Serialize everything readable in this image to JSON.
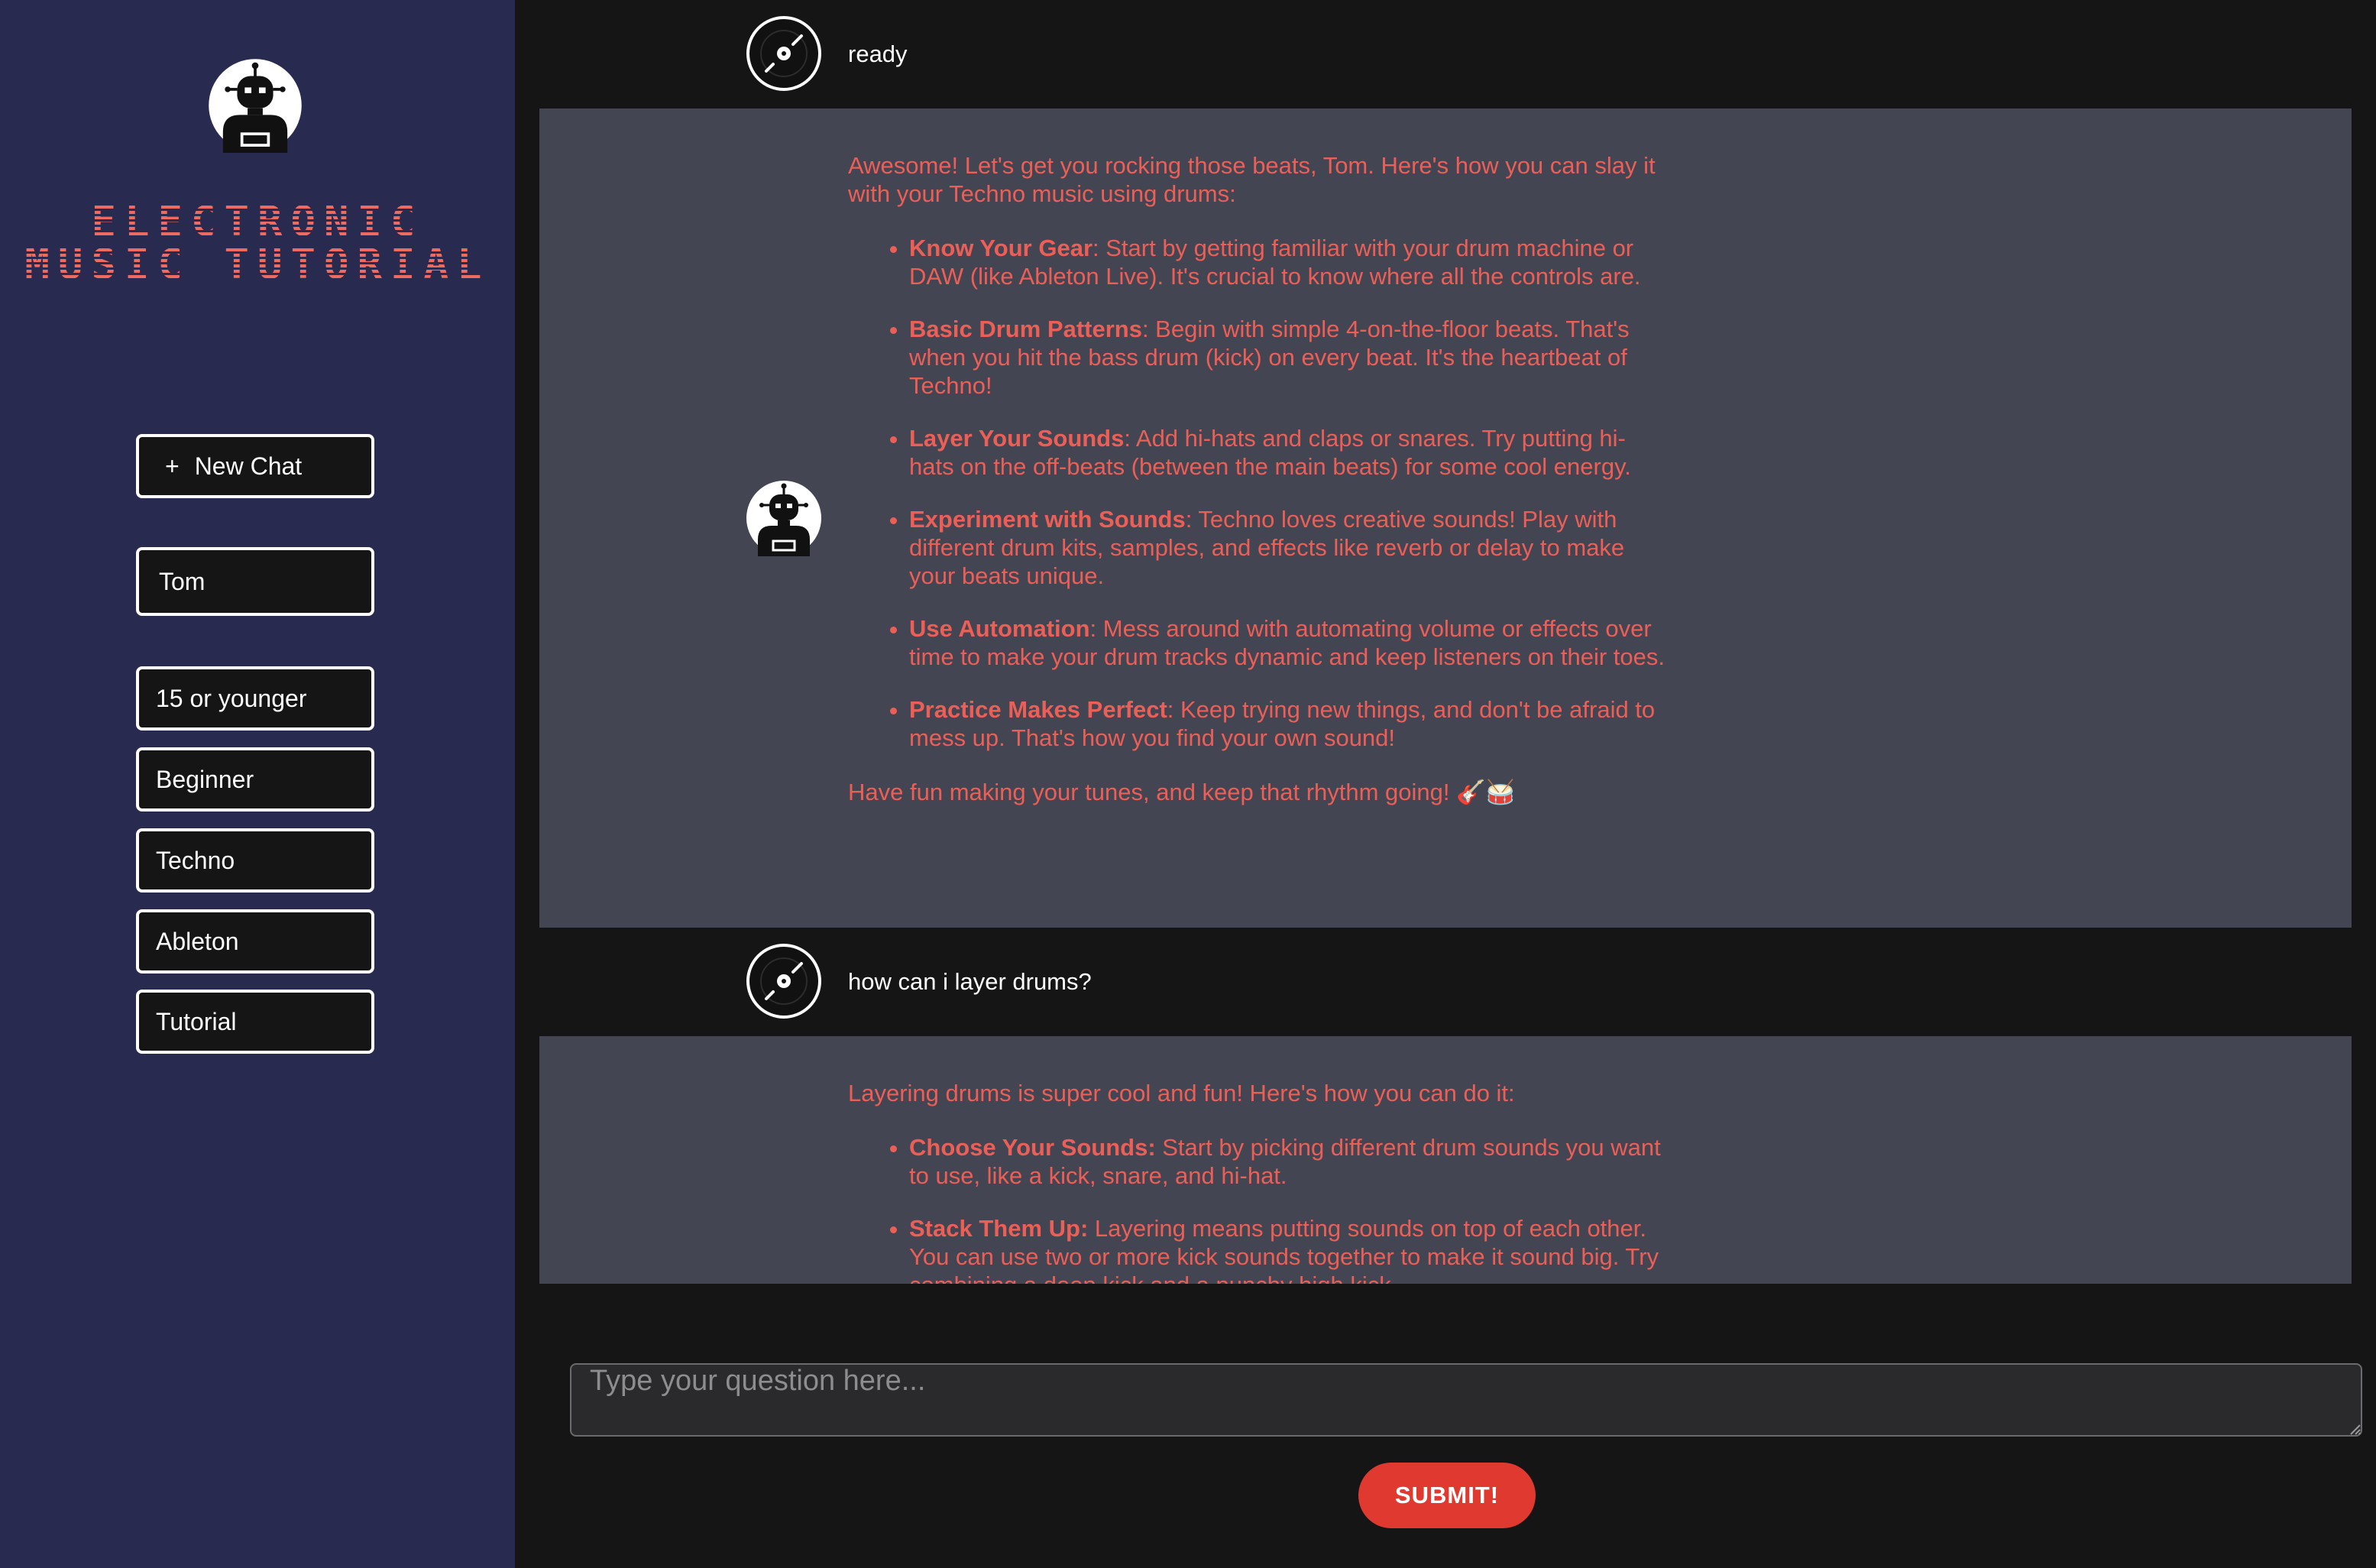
{
  "sidebar": {
    "title": "Electronic Music Tutorial",
    "new_chat_label": "New Chat",
    "name": "Tom",
    "age": "15 or younger",
    "level": "Beginner",
    "genre": "Techno",
    "software": "Ableton",
    "mode": "Tutorial"
  },
  "icons": {
    "logo": "robot-icon",
    "user_avatar": "vinyl-record-icon",
    "bot_avatar": "robot-icon",
    "new_chat": "plus-icon"
  },
  "messages": [
    {
      "role": "user",
      "text": "ready"
    },
    {
      "role": "bot",
      "intro": "Awesome! Let's get you rocking those beats, Tom. Here's how you can slay it with your Techno music using drums:",
      "items": [
        {
          "title": "Know Your Gear",
          "text": ": Start by getting familiar with your drum machine or DAW (like Ableton Live). It's crucial to know where all the controls are."
        },
        {
          "title": "Basic Drum Patterns",
          "text": ": Begin with simple 4-on-the-floor beats. That's when you hit the bass drum (kick) on every beat. It's the heartbeat of Techno!"
        },
        {
          "title": "Layer Your Sounds",
          "text": ": Add hi-hats and claps or snares. Try putting hi-hats on the off-beats (between the main beats) for some cool energy."
        },
        {
          "title": "Experiment with Sounds",
          "text": ": Techno loves creative sounds! Play with different drum kits, samples, and effects like reverb or delay to make your beats unique."
        },
        {
          "title": "Use Automation",
          "text": ": Mess around with automating volume or effects over time to make your drum tracks dynamic and keep listeners on their toes."
        },
        {
          "title": "Practice Makes Perfect",
          "text": ": Keep trying new things, and don't be afraid to mess up. That's how you find your own sound!"
        }
      ],
      "outro": "Have fun making your tunes, and keep that rhythm going! 🎸🥁"
    },
    {
      "role": "user",
      "text": "how can i layer drums?"
    },
    {
      "role": "bot",
      "intro": "Layering drums is super cool and fun! Here's how you can do it:",
      "items": [
        {
          "title": "Choose Your Sounds:",
          "text": " Start by picking different drum sounds you want to use, like a kick, snare, and hi-hat."
        },
        {
          "title": "Stack Them Up:",
          "text": " Layering means putting sounds on top of each other. You can use two or more kick sounds together to make it sound big. Try combining a deep kick and a punchy high kick."
        }
      ]
    }
  ],
  "input": {
    "placeholder": "Type your question here..."
  },
  "submit_label": "SUBMIT!",
  "colors": {
    "sidebar_bg": "#282a4f",
    "main_bg": "#151516",
    "bot_bubble_bg": "#444553",
    "bot_text": "#ec5f57",
    "title_text": "#ee6b62",
    "submit_bg": "#e03a30"
  }
}
